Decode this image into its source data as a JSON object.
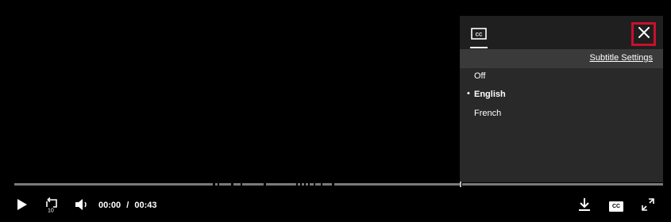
{
  "subtitles_panel": {
    "tab_icon": "closed-captions-icon",
    "close_icon": "close-icon",
    "highlight_color": "#c8102e",
    "settings_link": "Subtitle Settings",
    "options": [
      {
        "label": "Off",
        "selected": false
      },
      {
        "label": "English",
        "selected": true
      },
      {
        "label": "French",
        "selected": false
      }
    ],
    "selected_bullet": "•"
  },
  "player": {
    "current_time": "00:00",
    "separator": "/",
    "duration": "00:43",
    "progress": 0.0,
    "icons": {
      "play": "play-icon",
      "replay": "replay-10-icon",
      "replay_label": "10",
      "volume": "volume-icon",
      "download": "download-icon",
      "cc": "cc-icon",
      "cc_label": "CC",
      "fullscreen": "fullscreen-icon"
    }
  }
}
